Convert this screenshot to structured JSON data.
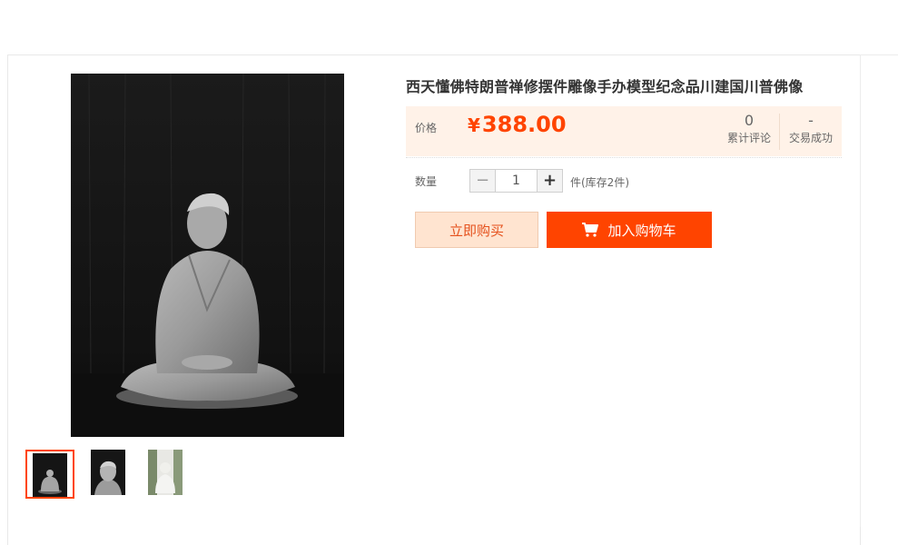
{
  "product": {
    "title": "西天懂佛特朗普禅修摆件雕像手办模型纪念品川建国川普佛像"
  },
  "price": {
    "label": "价格",
    "currency": "¥",
    "value": "388.00",
    "accent_color": "#ff4400"
  },
  "stats": {
    "reviews_count": "0",
    "reviews_label": "累计评论",
    "sales_count": "-",
    "sales_label": "交易成功"
  },
  "quantity": {
    "label": "数量",
    "minus_symbol": "−",
    "plus_symbol": "+",
    "value": "1",
    "stock_text": "件(库存2件)"
  },
  "actions": {
    "buy_now_label": "立即购买",
    "add_to_cart_label": "加入购物车",
    "cart_icon": "shopping-cart-icon"
  },
  "gallery": {
    "thumbnails": [
      "thumbnail-statue-dark",
      "thumbnail-statue-closeup",
      "thumbnail-statue-light"
    ],
    "active_index": 0
  }
}
